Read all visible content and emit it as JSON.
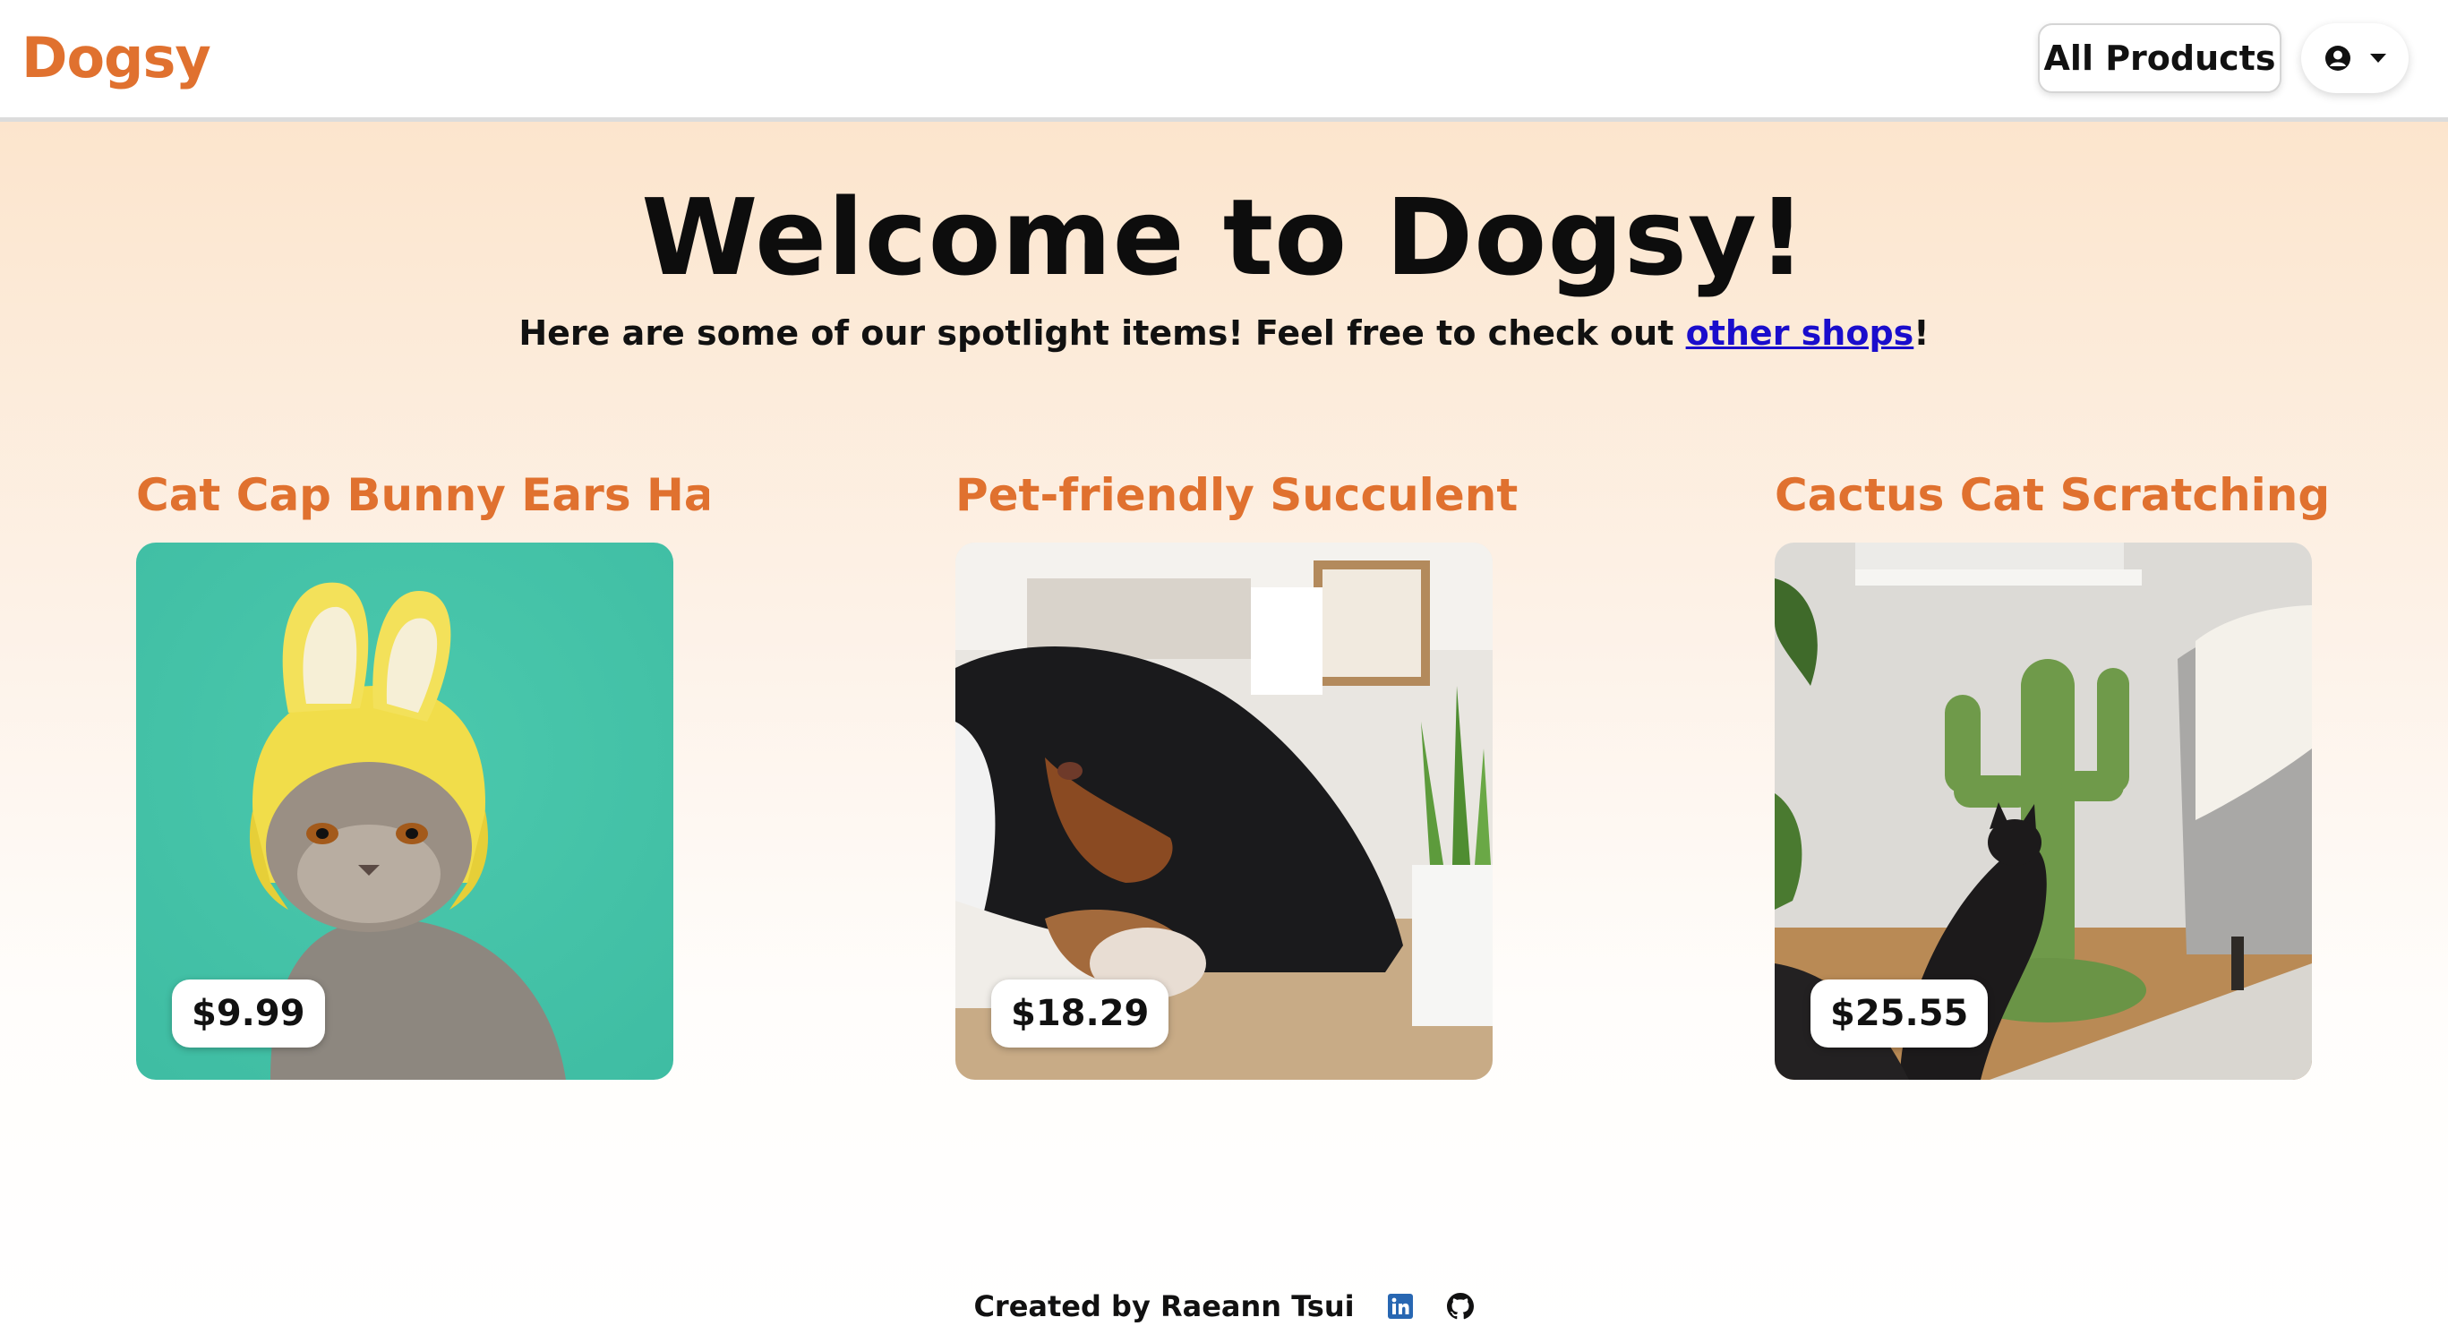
{
  "navbar": {
    "logo": "Dogsy",
    "all_products_label": "All Products",
    "user_icon": "user-circle-icon",
    "caret_icon": "caret-down-icon"
  },
  "hero": {
    "title": "Welcome to Dogsy!",
    "subtitle_prefix": "Here are some of our spotlight items! Feel free to check out ",
    "subtitle_link": "other shops",
    "subtitle_suffix": "!"
  },
  "products": [
    {
      "title": "Cat Cap Bunny Ears Ha...",
      "price": "$9.99",
      "image": "cat-with-bunny-ears-hat"
    },
    {
      "title": "Pet-friendly Succulent ...",
      "price": "$18.29",
      "image": "dog-lying-by-succulent"
    },
    {
      "title": "Cactus Cat Scratching ...",
      "price": "$25.55",
      "image": "black-cat-cactus-scratcher"
    }
  ],
  "footer": {
    "credit": "Created by Raeann Tsui",
    "linkedin_icon": "linkedin-icon",
    "github_icon": "github-icon"
  },
  "colors": {
    "brand": "#e0712f",
    "link": "#1a0dcc",
    "hero_top": "#fce5cd"
  }
}
